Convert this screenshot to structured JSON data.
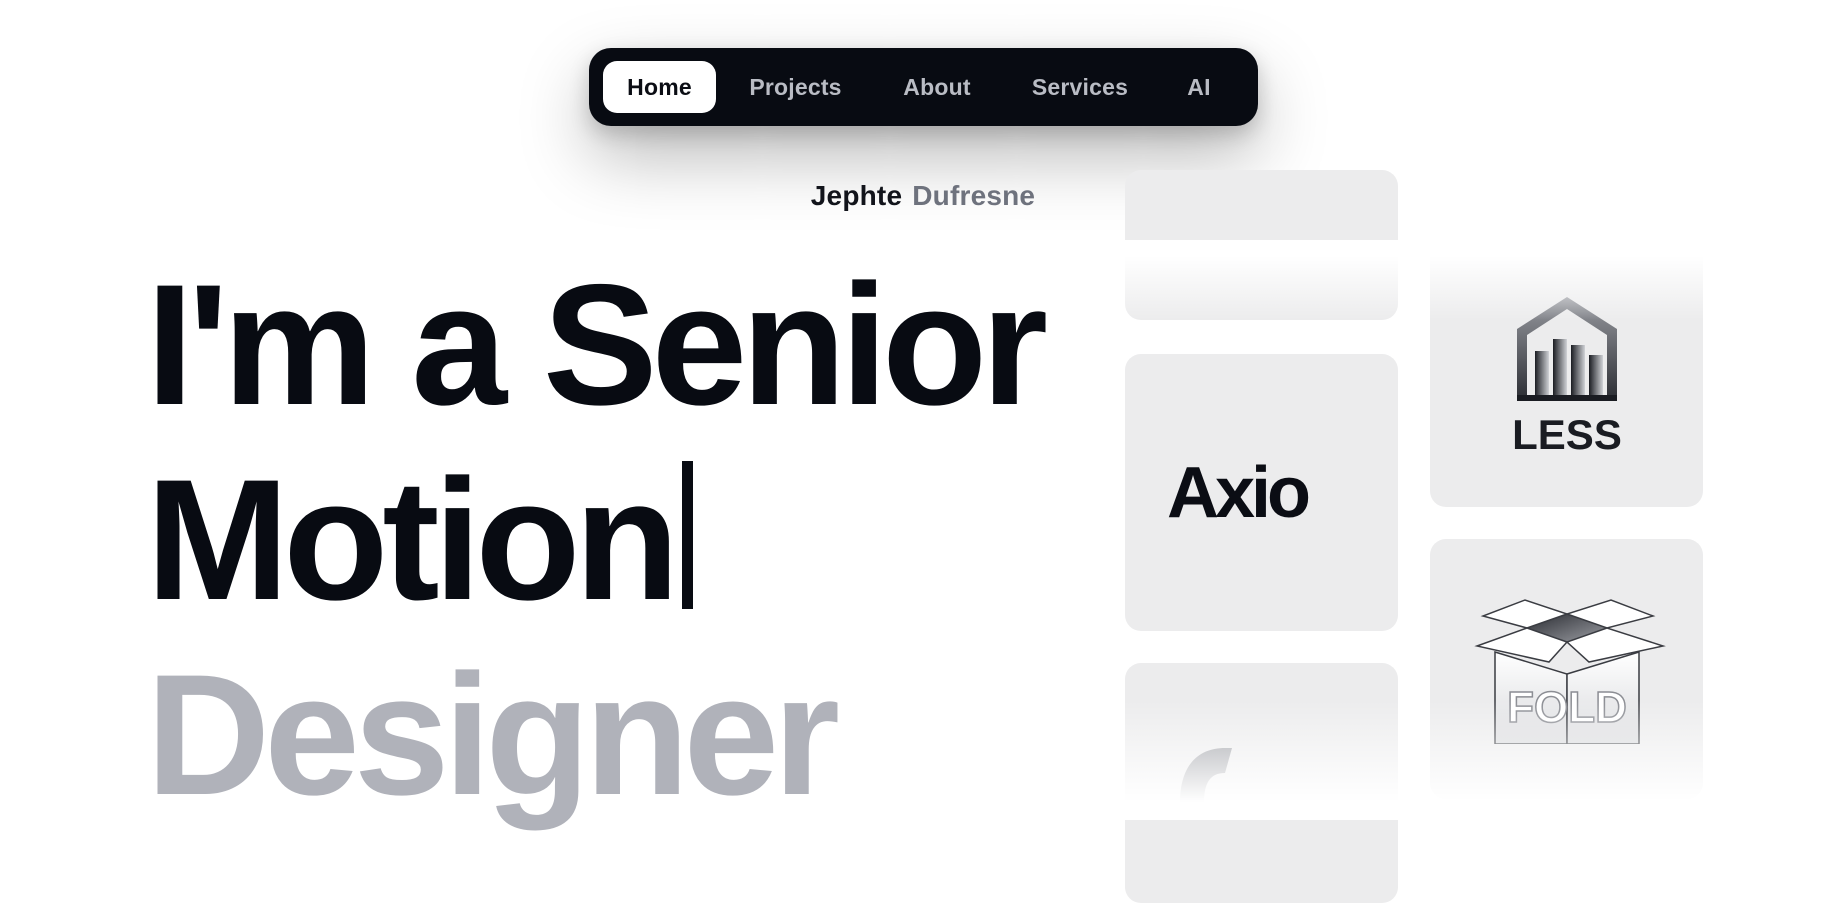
{
  "nav": {
    "items": [
      {
        "label": "Home",
        "active": true
      },
      {
        "label": "Projects",
        "active": false
      },
      {
        "label": "About",
        "active": false
      },
      {
        "label": "Services",
        "active": false
      },
      {
        "label": "AI",
        "active": false
      }
    ]
  },
  "name": {
    "first": "Jephte",
    "last": "Dufresne"
  },
  "headline": {
    "line1": "I'm a Senior",
    "line2": "Motion",
    "line3": "Designer"
  },
  "logos": [
    {
      "label": "Axio",
      "icon": "axio-logo"
    },
    {
      "label": "LESS",
      "icon": "less-house-logo"
    },
    {
      "label": "FOLD",
      "icon": "fold-box-logo"
    }
  ],
  "colors": {
    "nav_bg": "#080b12",
    "text_dark": "#080b12",
    "text_muted": "#b0b2ba",
    "card_bg": "#ececed"
  }
}
